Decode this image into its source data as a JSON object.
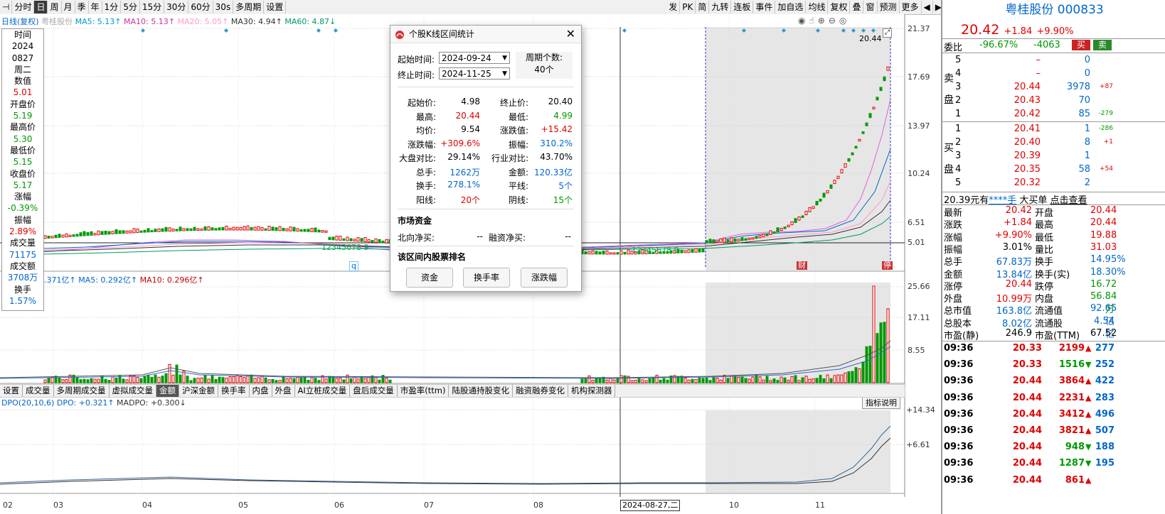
{
  "toolbar": {
    "left_items": [
      "分时",
      "日",
      "周",
      "月",
      "季",
      "年",
      "1分",
      "5分",
      "15分",
      "30分",
      "60分",
      "30s",
      "多周期",
      "设置"
    ],
    "selected": "日",
    "right_items": [
      "发",
      "PK",
      "简",
      "九转",
      "连板",
      "事件",
      "加自选",
      "均线",
      "复权",
      "叠",
      "窗",
      "预测",
      "更多"
    ]
  },
  "legend_main": {
    "name": "日线(复权)",
    "stock": "粤桂股份",
    "ma5": "MA5: 5.13↑",
    "ma10": "MA10: 5.13↑",
    "ma20": "MA20: 5.05↑",
    "ma30": "MA30: 4.94↑",
    "ma60": "MA60: 4.87↓"
  },
  "price_axis": [
    "21.37",
    "17.69",
    "13.97",
    "10.24",
    "6.51",
    "5.01"
  ],
  "latest_marker": "20.44",
  "vol_axis": [
    "25.66",
    "17.11",
    "8.55"
  ],
  "dpo_axis": [
    "+14.34",
    "+6.61"
  ],
  "legend_vol": {
    "amount": ".371亿↑",
    "ma5": "MA5: 0.292亿↑",
    "ma10": "MA10: 0.296亿↑"
  },
  "legend_dpo": {
    "dpo_name": "DPO(20,10,6)",
    "dpo": "DPO: +0.321↑",
    "madpo": "MADPO: +0.300↓"
  },
  "indicator_help": "指标说明",
  "months": [
    "02",
    "03",
    "04",
    "05",
    "06",
    "07",
    "08",
    "10",
    "11"
  ],
  "crosshair_date": "2024-08-27,二",
  "markers": {
    "q": "q",
    "cai": "财",
    "pei": "停"
  },
  "td_seq_left": "12345678 9",
  "td_seq_right": "12345678 9",
  "info_panel": [
    {
      "label": "时间",
      "value": "2024"
    },
    {
      "label": "",
      "value": "0827"
    },
    {
      "label": "",
      "value": "周二"
    },
    {
      "label": "数值",
      "value": "5.01"
    },
    {
      "label": "开盘价",
      "value": "5.19"
    },
    {
      "label": "最高价",
      "value": "5.30"
    },
    {
      "label": "最低价",
      "value": "5.15"
    },
    {
      "label": "收盘价",
      "value": "5.17"
    },
    {
      "label": "涨幅",
      "value": "-0.39%"
    },
    {
      "label": "振幅",
      "value": "2.89%"
    },
    {
      "label": "成交量",
      "value": "71175"
    },
    {
      "label": "成交额",
      "value": "3708万"
    },
    {
      "label": "换手",
      "value": "1.57%"
    }
  ],
  "indicator_tabs": [
    "设置",
    "成交量",
    "多周期成交量",
    "虚拟成交量",
    "金额",
    "沪深金额",
    "换手率",
    "内盘",
    "外盘",
    "AI立桩成交量",
    "盘后成交量",
    "市盈率(ttm)",
    "陆股通持股变化",
    "融资融券变化",
    "机构探测器"
  ],
  "indicator_selected": "金额",
  "dialog": {
    "title": "个股K线区间统计",
    "start_label": "起始时间:",
    "start_value": "2024-09-24",
    "end_label": "终止时间:",
    "end_value": "2024-11-25",
    "period_label": "周期个数:",
    "period_value": "40个",
    "stats": [
      {
        "l1": "起始价:",
        "v1": "4.98",
        "c1": "k",
        "l2": "终止价:",
        "v2": "20.40",
        "c2": "k"
      },
      {
        "l1": "最高:",
        "v1": "20.44",
        "c1": "r",
        "l2": "最低:",
        "v2": "4.99",
        "c2": "g"
      },
      {
        "l1": "均价:",
        "v1": "9.54",
        "c1": "k",
        "l2": "涨跌值:",
        "v2": "+15.42",
        "c2": "r"
      },
      {
        "l1": "涨跌幅:",
        "v1": "+309.6%",
        "c1": "r",
        "l2": "振幅:",
        "v2": "310.2%",
        "c2": "b"
      },
      {
        "l1": "大盘对比:",
        "v1": "29.14%",
        "c1": "k",
        "l2": "行业对比:",
        "v2": "43.70%",
        "c2": "k"
      },
      {
        "l1": "总手:",
        "v1": "1262万",
        "c1": "b",
        "l2": "金额:",
        "v2": "120.33亿",
        "c2": "b"
      },
      {
        "l1": "换手:",
        "v1": "278.1%",
        "c1": "b",
        "l2": "平线:",
        "v2": "5个",
        "c2": "b"
      },
      {
        "l1": "阳线:",
        "v1": "20个",
        "c1": "r",
        "l2": "阴线:",
        "v2": "15个",
        "c2": "g"
      }
    ],
    "capital_title": "市场资金",
    "north_label": "北向净买:",
    "north_value": "--",
    "margin_label": "融资净买:",
    "margin_value": "--",
    "rank_title": "该区间内股票排名",
    "buttons": [
      "资金",
      "换手率",
      "涨跌幅"
    ]
  },
  "right": {
    "name": "粤桂股份",
    "code": "000833",
    "price": "20.42",
    "change": "+1.84",
    "pct": "+9.90%",
    "weibi_label": "委比",
    "weibi": "-96.67%",
    "weicha": "-4063",
    "buy_btn": "买",
    "sell_btn": "卖",
    "sell_side": "卖盘",
    "buy_side": "买盘",
    "asks": [
      {
        "lvl": "5",
        "price": "–",
        "vol": "0",
        "chg": ""
      },
      {
        "lvl": "4",
        "price": "–",
        "vol": "0",
        "chg": ""
      },
      {
        "lvl": "3",
        "price": "20.44",
        "vol": "3978",
        "chg": "+87"
      },
      {
        "lvl": "2",
        "price": "20.43",
        "vol": "70",
        "chg": ""
      },
      {
        "lvl": "1",
        "price": "20.42",
        "vol": "85",
        "chg": "-279"
      }
    ],
    "bids": [
      {
        "lvl": "1",
        "price": "20.41",
        "vol": "1",
        "chg": "-286"
      },
      {
        "lvl": "2",
        "price": "20.40",
        "vol": "8",
        "chg": "+1"
      },
      {
        "lvl": "3",
        "price": "20.39",
        "vol": "1",
        "chg": ""
      },
      {
        "lvl": "4",
        "price": "20.35",
        "vol": "58",
        "chg": "+54"
      },
      {
        "lvl": "5",
        "price": "20.32",
        "vol": "2",
        "chg": ""
      }
    ],
    "bigorder": {
      "a": "20.39元有",
      "b": "****手",
      "c": "大买单",
      "d": "点击查看"
    },
    "quote": [
      {
        "l1": "最新",
        "v1": "20.42",
        "c1": "r",
        "l2": "开盘",
        "v2": "20.44",
        "c2": "r"
      },
      {
        "l1": "涨跌",
        "v1": "+1.84",
        "c1": "r",
        "l2": "最高",
        "v2": "20.44",
        "c2": "r"
      },
      {
        "l1": "涨幅",
        "v1": "+9.90%",
        "c1": "r",
        "l2": "最低",
        "v2": "19.88",
        "c2": "r"
      },
      {
        "l1": "振幅",
        "v1": "3.01%",
        "c1": "k",
        "l2": "量比",
        "v2": "31.03",
        "c2": "r"
      },
      {
        "l1": "总手",
        "v1": "67.83万",
        "c1": "b",
        "l2": "换手",
        "v2": "14.95%",
        "c2": "b"
      },
      {
        "l1": "金额",
        "v1": "13.84亿",
        "c1": "b",
        "l2": "换手(实)",
        "v2": "18.30%",
        "c2": "b"
      },
      {
        "l1": "涨停",
        "v1": "20.44",
        "c1": "r",
        "l2": "跌停",
        "v2": "16.72",
        "c2": "g"
      },
      {
        "l1": "外盘",
        "v1": "10.99万",
        "c1": "r",
        "l2": "内盘",
        "v2": "56.84万",
        "c2": "g"
      },
      {
        "l1": "总市值",
        "v1": "163.8亿",
        "c1": "b",
        "l2": "流通值",
        "v2": "92.65亿",
        "c2": "b"
      },
      {
        "l1": "总股本",
        "v1": "8.02亿",
        "c1": "b",
        "l2": "流通股",
        "v2": "4.54亿",
        "c2": "b"
      },
      {
        "l1": "市盈(静)",
        "v1": "246.9",
        "c1": "k",
        "l2": "市盈(TTM)",
        "v2": "67.52",
        "c2": "k"
      }
    ],
    "ticks": [
      {
        "t": "09:36",
        "p": "20.33",
        "v": "2199",
        "d": "up",
        "n": "277"
      },
      {
        "t": "09:36",
        "p": "20.33",
        "v": "1516",
        "d": "down",
        "n": "252"
      },
      {
        "t": "09:36",
        "p": "20.44",
        "v": "3864",
        "d": "up",
        "n": "422"
      },
      {
        "t": "09:36",
        "p": "20.44",
        "v": "2231",
        "d": "up",
        "n": "283"
      },
      {
        "t": "09:36",
        "p": "20.44",
        "v": "3412",
        "d": "up",
        "n": "496"
      },
      {
        "t": "09:36",
        "p": "20.44",
        "v": "3821",
        "d": "up",
        "n": "507"
      },
      {
        "t": "09:36",
        "p": "20.44",
        "v": "948",
        "d": "down",
        "n": "188"
      },
      {
        "t": "09:36",
        "p": "20.44",
        "v": "1287",
        "d": "down",
        "n": "195"
      },
      {
        "t": "09:36",
        "p": "20.44",
        "v": "861",
        "d": "up",
        "n": ""
      }
    ]
  },
  "colors": {
    "up": "#e00000",
    "down": "#009900",
    "blue": "#0066cc",
    "gray_bg": "#e8e8e8"
  }
}
